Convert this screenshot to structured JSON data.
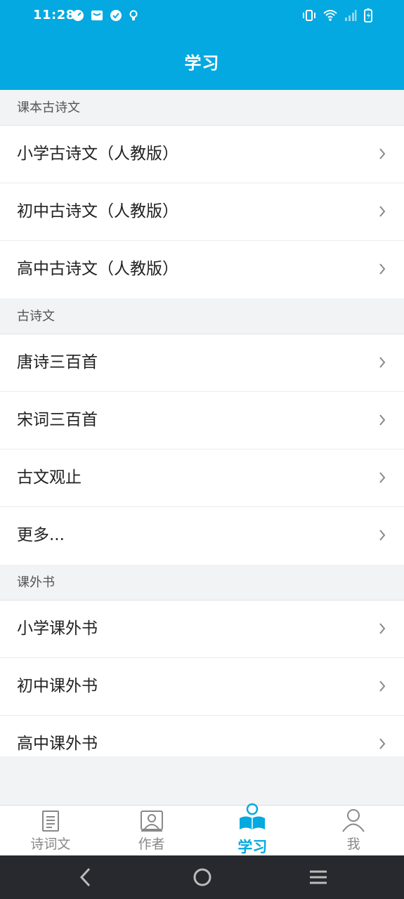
{
  "status_bar": {
    "time": "11:28"
  },
  "header": {
    "title": "学习"
  },
  "sections": [
    {
      "header": "课本古诗文",
      "items": [
        {
          "label": "小学古诗文（人教版）"
        },
        {
          "label": "初中古诗文（人教版）"
        },
        {
          "label": "高中古诗文（人教版）"
        }
      ]
    },
    {
      "header": "古诗文",
      "items": [
        {
          "label": "唐诗三百首"
        },
        {
          "label": "宋词三百首"
        },
        {
          "label": "古文观止"
        },
        {
          "label": "更多..."
        }
      ]
    },
    {
      "header": "课外书",
      "items": [
        {
          "label": "小学课外书"
        },
        {
          "label": "初中课外书"
        },
        {
          "label": "高中课外书"
        }
      ]
    }
  ],
  "tabs": [
    {
      "label": "诗词文",
      "icon": "document-icon",
      "active": false
    },
    {
      "label": "作者",
      "icon": "author-card-icon",
      "active": false
    },
    {
      "label": "学习",
      "icon": "reading-person-icon",
      "active": true
    },
    {
      "label": "我",
      "icon": "profile-icon",
      "active": false
    }
  ],
  "colors": {
    "accent": "#03a9e0",
    "background": "#f2f3f5",
    "nav_bar": "#28292e"
  }
}
